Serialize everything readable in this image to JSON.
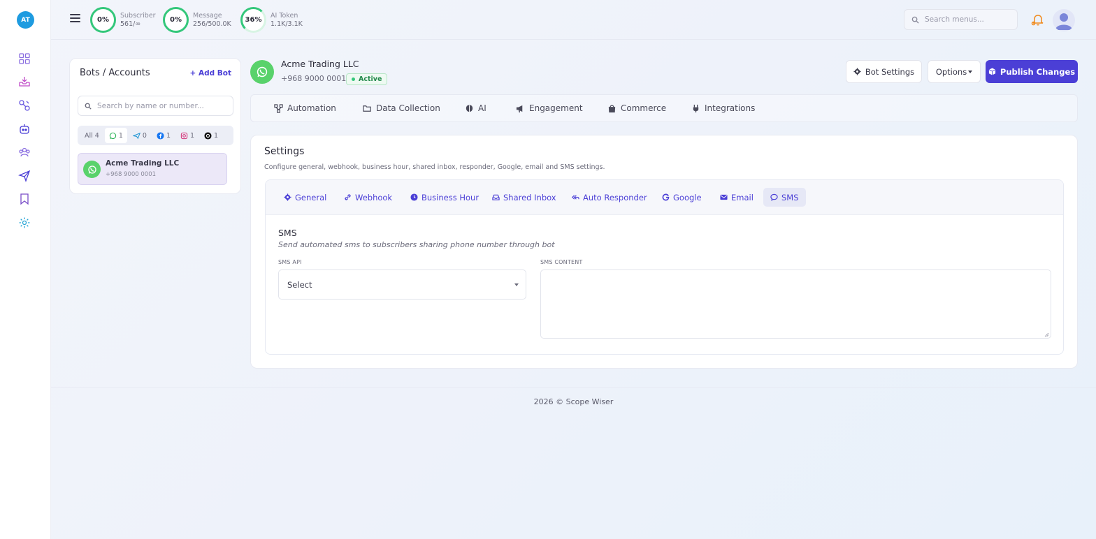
{
  "rail": {
    "avatar_initials": "AT",
    "items": [
      "dashboard-icon",
      "inbox-icon",
      "links-icon",
      "bot-icon",
      "users-icon",
      "send-icon",
      "bookmark-icon",
      "settings-icon"
    ]
  },
  "stats": [
    {
      "percent": "0%",
      "label": "Subscriber",
      "value": "561/∞"
    },
    {
      "percent": "0%",
      "label": "Message",
      "value": "256/500.0K"
    },
    {
      "percent": "36%",
      "label": "AI Token",
      "value": "1.1K/3.1K"
    }
  ],
  "search": {
    "placeholder": "Search menus..."
  },
  "bots": {
    "title": "Bots / Accounts",
    "add_label": "Add Bot",
    "search_placeholder": "Search by name or number...",
    "filters": {
      "all": "All 4",
      "whatsapp": "1",
      "telegram": "0",
      "facebook": "1",
      "instagram": "1",
      "threads": "1"
    },
    "items": [
      {
        "name": "Acme Trading LLC",
        "phone": "+968 9000 0001"
      }
    ]
  },
  "account": {
    "name": "Acme Trading LLC",
    "phone": "+968 9000 0001",
    "status": "Active"
  },
  "actions": {
    "bot_settings": "Bot Settings",
    "options": "Options",
    "publish": "Publish Changes"
  },
  "section_tabs": [
    "Automation",
    "Data Collection",
    "AI",
    "Engagement",
    "Commerce",
    "Integrations"
  ],
  "settings": {
    "title": "Settings",
    "description": "Configure general, webhook, business hour, shared inbox, responder, Google, email and SMS settings.",
    "tabs": [
      "General",
      "Webhook",
      "Business Hour",
      "Shared Inbox",
      "Auto Responder",
      "Google",
      "Email",
      "SMS"
    ],
    "active_tab": "SMS",
    "sms": {
      "title": "SMS",
      "subtitle": "Send automated sms to subscribers sharing phone number through bot",
      "api_label": "SMS API",
      "api_selected": "Select",
      "content_label": "SMS CONTENT",
      "content_value": ""
    }
  },
  "footer": {
    "text": "2026 © Scope Wiser"
  },
  "colors": {
    "primary": "#4b3fd6",
    "success": "#34c77b",
    "whatsapp": "#59d26b",
    "avatar": "#1e9be0"
  }
}
